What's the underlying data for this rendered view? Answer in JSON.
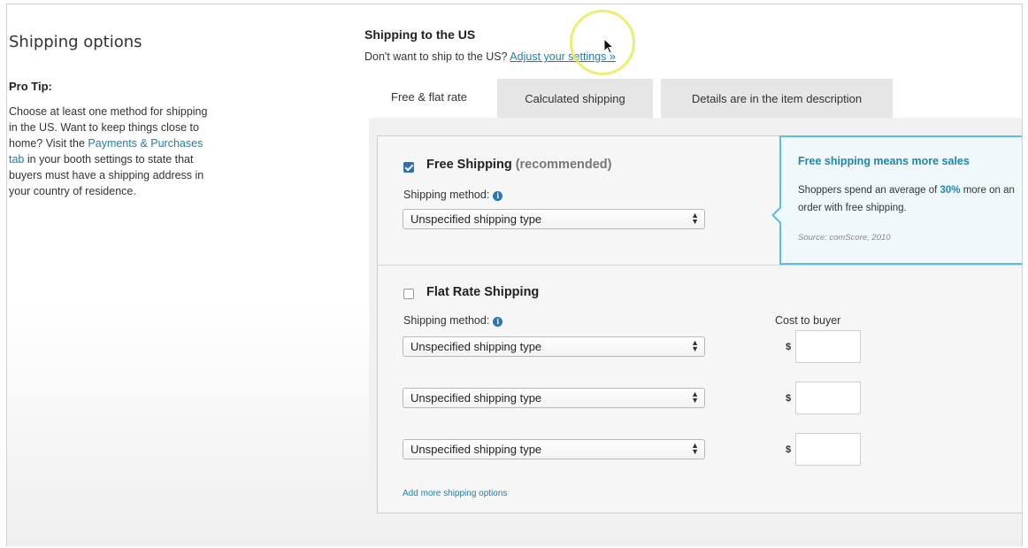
{
  "sidebar": {
    "title": "Shipping options",
    "pro_tip_title": "Pro Tip:",
    "pro_tip_text_1": "Choose at least one method for shipping in the US. Want to keep things close to home? Visit the ",
    "pro_tip_link": "Payments & Purchases tab",
    "pro_tip_text_2": " in your booth settings to state that buyers must have a shipping address in your country of residence."
  },
  "main": {
    "title": "Shipping to the US",
    "subtitle_prefix": "Don't want to ship to the US? ",
    "subtitle_link": "Adjust your settings »",
    "tabs": [
      {
        "label": "Free & flat rate",
        "active": true
      },
      {
        "label": "Calculated shipping",
        "active": false
      },
      {
        "label": "Details are in the item description",
        "active": false
      }
    ]
  },
  "free_shipping": {
    "checked": true,
    "title": "Free Shipping",
    "title_suffix": "(recommended)",
    "method_label": "Shipping method:",
    "select_value": "Unspecified shipping type"
  },
  "callout": {
    "title": "Free shipping means more sales",
    "body_prefix": "Shoppers spend an average of ",
    "body_pct": "30%",
    "body_suffix": " more on an order with free shipping.",
    "source": "Source: comScore, 2010"
  },
  "flat_rate": {
    "checked": false,
    "title": "Flat Rate Shipping",
    "method_label": "Shipping method:",
    "cost_label": "Cost to buyer",
    "currency": "$",
    "rows": [
      {
        "select_value": "Unspecified shipping type",
        "cost": ""
      },
      {
        "select_value": "Unspecified shipping type",
        "cost": ""
      },
      {
        "select_value": "Unspecified shipping type",
        "cost": ""
      }
    ],
    "add_more": "Add more shipping options"
  },
  "icons": {
    "info": "info-icon",
    "select_arrows": "updown-arrows-icon",
    "cursor": "mouse-pointer-icon"
  },
  "colors": {
    "link": "#1d7fae",
    "callout_border": "#5bc0de",
    "checkbox_checked": "#2f6fb3",
    "cursor_highlight": "#e9ea5a"
  }
}
